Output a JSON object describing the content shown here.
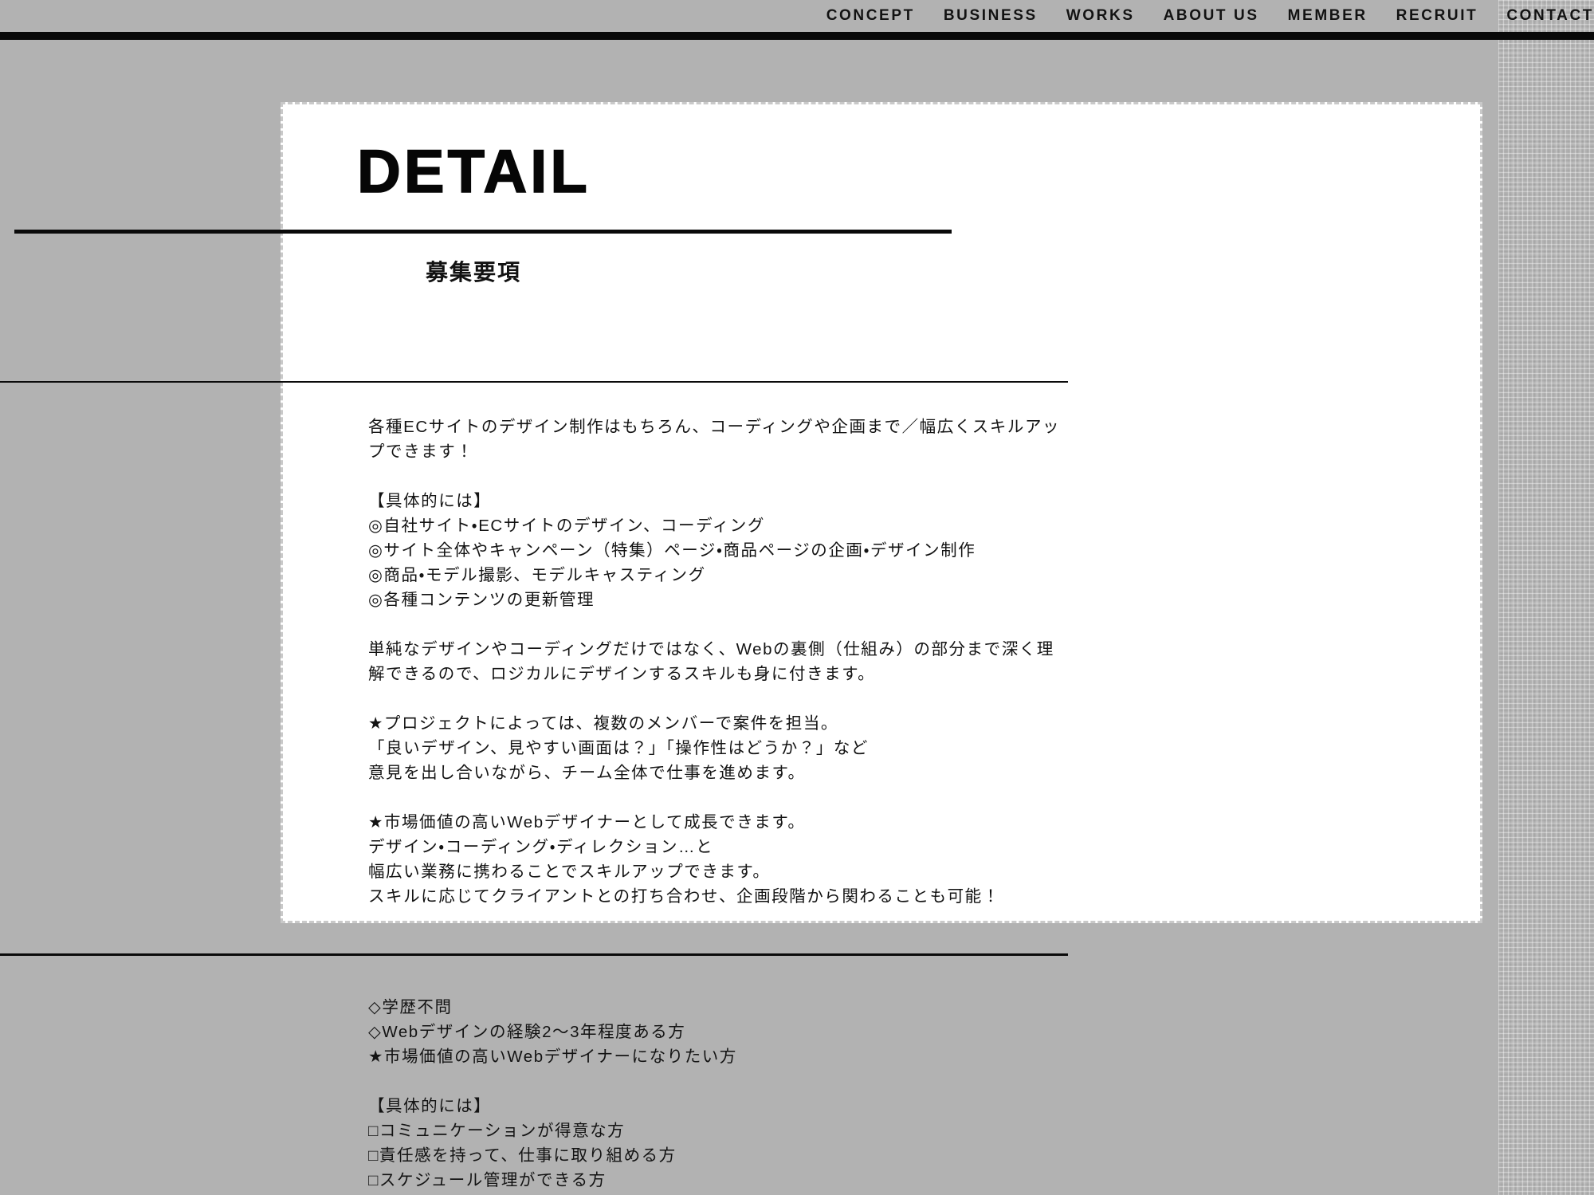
{
  "header": {
    "nav_items": [
      {
        "label": "CONCEPT"
      },
      {
        "label": "BUSINESS"
      },
      {
        "label": "WORKS"
      },
      {
        "label": "ABOUT US"
      },
      {
        "label": "MEMBER"
      },
      {
        "label": "RECRUIT"
      },
      {
        "label": "CONTACT"
      }
    ]
  },
  "page": {
    "title": "DETAIL",
    "subtitle": "募集要項"
  },
  "colors": {
    "background": "#b2b2b2",
    "panel": "#ffffff",
    "rule": "#0a0a0a",
    "text": "#131313",
    "panel_border": "#c9c9c9"
  },
  "detail": {
    "paragraphs": [
      {
        "id": "intro",
        "lines": [
          "各種ECサイトのデザイン制作はもちろん、コーディングや企画まで／幅広くスキルアッ",
          "プできます！"
        ]
      },
      {
        "id": "concrete-tasks",
        "lines": [
          "【具体的には】",
          "◎自社サイト・ECサイトのデザイン、コーディング",
          "◎サイト全体やキャンペーン（特集）ページ・商品ページの企画・デザイン制作",
          "◎商品・モデル撮影、モデルキャスティング",
          "◎各種コンテンツの更新管理"
        ]
      },
      {
        "id": "logical-design",
        "lines": [
          "単純なデザインやコーディングだけではなく、Webの裏側（仕組み）の部分まで深く理",
          "解できるので、ロジカルにデザインするスキルも身に付きます。"
        ]
      },
      {
        "id": "team-project",
        "lines": [
          "★プロジェクトによっては、複数のメンバーで案件を担当。",
          "「良いデザイン、見やすい画面は？」「操作性はどうか？」など",
          "意見を出し合いながら、チーム全体で仕事を進めます。"
        ]
      },
      {
        "id": "market-value",
        "lines": [
          "★市場価値の高いWebデザイナーとして成長できます。",
          "デザイン・コーディング・ディレクション…と",
          "幅広い業務に携わることでスキルアップできます。",
          "スキルに応じてクライアントとの打ち合わせ、企画段階から関わることも可能！"
        ]
      }
    ]
  },
  "requirements": {
    "paragraphs": [
      {
        "id": "qualifications",
        "lines": [
          "◇学歴不問",
          "◇Webデザインの経験2〜3年程度ある方",
          "★市場価値の高いWebデザイナーになりたい方"
        ]
      },
      {
        "id": "concrete-qualities",
        "lines": [
          "【具体的には】",
          "□コミュニケーションが得意な方",
          "□責任感を持って、仕事に取り組める方",
          "□スケジュール管理ができる方"
        ]
      }
    ]
  }
}
